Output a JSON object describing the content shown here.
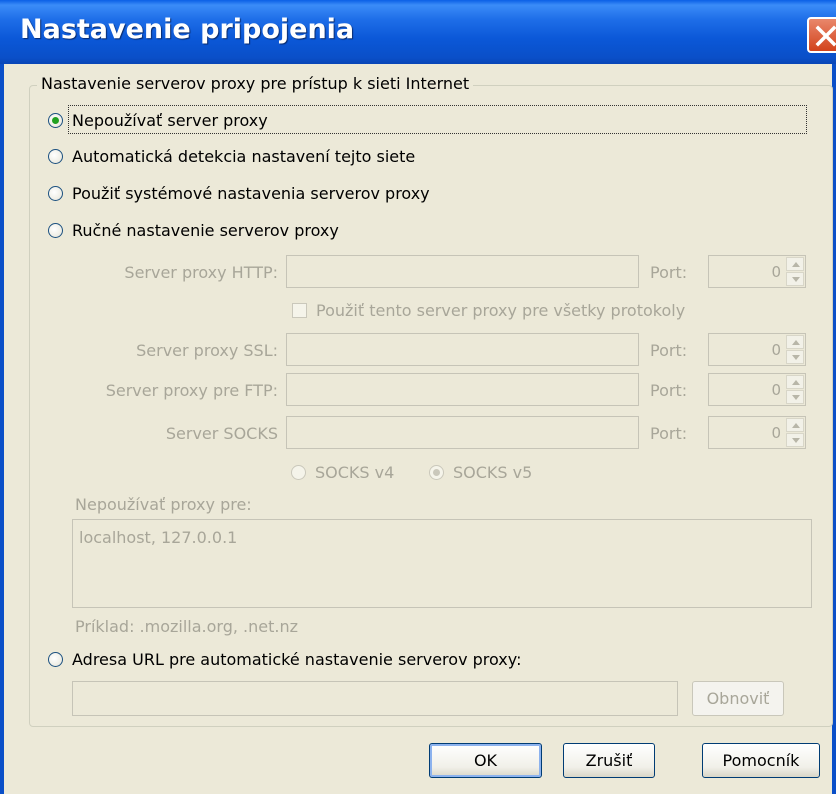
{
  "window": {
    "title": "Nastavenie pripojenia"
  },
  "group": {
    "legend": "Nastavenie serverov proxy pre prístup k sieti Internet"
  },
  "options": {
    "no_proxy": "Nepoužívať server proxy",
    "auto_detect": "Automatická detekcia nastavení tejto siete",
    "system": "Použiť systémové nastavenia serverov proxy",
    "manual": "Ručné nastavenie serverov proxy",
    "auto_url": "Adresa URL pre automatické nastavenie serverov proxy:",
    "selected": "no_proxy"
  },
  "manual": {
    "http_label": "Server proxy HTTP:",
    "http_value": "",
    "port_label": "Port:",
    "http_port": "0",
    "use_for_all_label": "Použiť tento server proxy pre všetky protokoly",
    "ssl_label": "Server proxy SSL:",
    "ssl_value": "",
    "ssl_port": "0",
    "ftp_label": "Server proxy pre FTP:",
    "ftp_value": "",
    "ftp_port": "0",
    "socks_label": "Server SOCKS",
    "socks_value": "",
    "socks_port": "0",
    "socks_v4": "SOCKS v4",
    "socks_v5": "SOCKS v5",
    "no_proxy_for_label": "Nepoužívať proxy pre:",
    "no_proxy_for_value": "localhost, 127.0.0.1",
    "example": "Príklad: .mozilla.org, .net.nz"
  },
  "auto_url": {
    "value": "",
    "reload_label": "Obnoviť"
  },
  "buttons": {
    "ok": "OK",
    "cancel": "Zrušiť",
    "help": "Pomocník"
  }
}
